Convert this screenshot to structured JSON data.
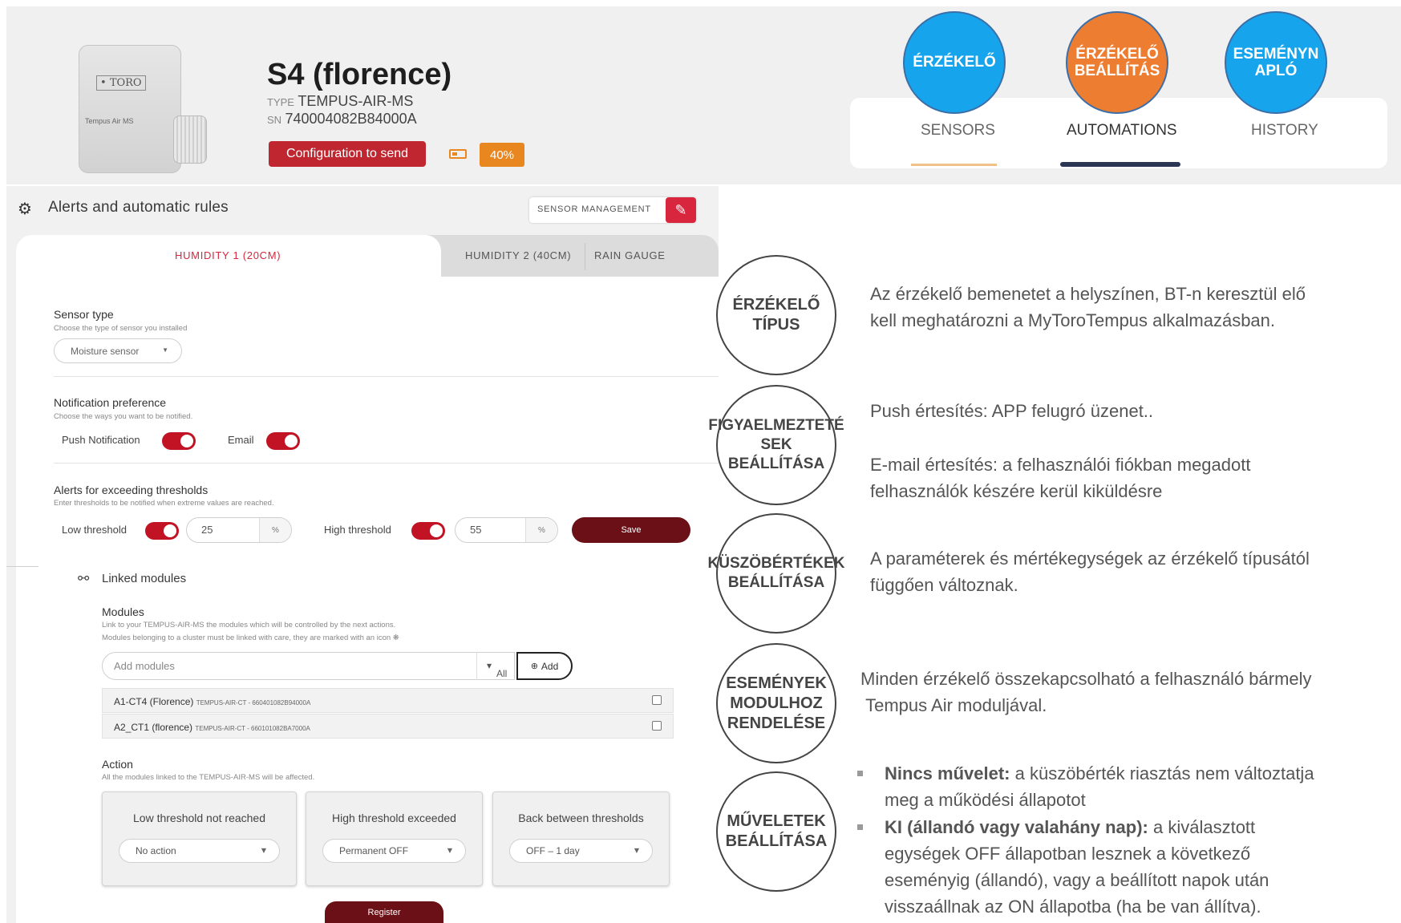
{
  "header": {
    "device": {
      "logo": "TORO",
      "model_name": "Tempus Air MS",
      "title": "S4 (florence)",
      "type_key": "TYPE",
      "type_value": "TEMPUS-AIR-MS",
      "sn_key": "SN",
      "sn_value": "740004082B84000A",
      "config_badge": "Configuration to send",
      "battery_label": "40%",
      "battery_level": 0.4
    },
    "nav": {
      "tabs": [
        {
          "label": "SENSORS"
        },
        {
          "label": "AUTOMATIONS",
          "active": true
        },
        {
          "label": "HISTORY"
        }
      ]
    },
    "overlay_bubbles": [
      {
        "label_1": "ÉRZÉKELŐ",
        "label_2": "",
        "color": "#16a5ec"
      },
      {
        "label_1": "ÉRZÉKELŐ",
        "label_2": "BEÁLLÍTÁS",
        "color": "#ed7d31"
      },
      {
        "label_1": "ESEMÉNYN",
        "label_2": "APLÓ",
        "color": "#16a5ec"
      }
    ]
  },
  "panel": {
    "title": "Alerts and automatic rules",
    "sensor_management": "SENSOR MANAGEMENT",
    "tabs": [
      {
        "label": "HUMIDITY 1 (20CM)",
        "active": true
      },
      {
        "label": "HUMIDITY 2 (40CM)"
      },
      {
        "label": "RAIN GAUGE"
      }
    ],
    "sensor_type": {
      "title": "Sensor type",
      "subtitle": "Choose the type of sensor you installed",
      "value": "Moisture sensor"
    },
    "notification": {
      "title": "Notification preference",
      "subtitle": "Choose the ways you want to be notified.",
      "push_label": "Push Notification",
      "push_on": true,
      "email_label": "Email",
      "email_on": true
    },
    "thresholds": {
      "title": "Alerts for exceeding thresholds",
      "subtitle": "Enter thresholds to be notified when extreme values are reached.",
      "low_label": "Low threshold",
      "low_on": true,
      "low_value": "25",
      "high_label": "High threshold",
      "high_on": true,
      "high_value": "55",
      "unit": "%",
      "save_label": "Save"
    },
    "linked": {
      "title": "Linked modules",
      "modules_title": "Modules",
      "modules_sub1": "Link to your TEMPUS-AIR-MS the modules which will be controlled by the next actions.",
      "modules_sub2": "Modules belonging to a cluster must be linked with care, they are marked with an icon",
      "input_placeholder": "Add modules",
      "filter_value": "All",
      "add_label": "Add",
      "modules": [
        {
          "name": "A1-CT4 (Florence)",
          "code": "TEMPUS-AIR-CT - 660401082B94000A",
          "checked": false
        },
        {
          "name": "A2_CT1 (florence)",
          "code": "TEMPUS-AIR-CT - 660101082BA7000A",
          "checked": false
        }
      ]
    },
    "action": {
      "title": "Action",
      "subtitle": "All the modules linked to the TEMPUS-AIR-MS will be affected.",
      "boxes": [
        {
          "title": "Low threshold not reached",
          "value": "No action"
        },
        {
          "title": "High threshold exceeded",
          "value": "Permanent OFF"
        },
        {
          "title": "Back between thresholds",
          "value": "OFF – 1 day"
        }
      ],
      "register_label": "Register"
    }
  },
  "annotations": {
    "circles": [
      {
        "l1": "ÉRZÉKELŐ",
        "l2": "TÍPUS",
        "l3": ""
      },
      {
        "l1": "FIGYAELMEZTETÉ",
        "l2": "SEK",
        "l3": "BEÁLLÍTÁSA"
      },
      {
        "l1": "KÜSZÖBÉRTÉKEK",
        "l2": "BEÁLLÍTÁSA",
        "l3": ""
      },
      {
        "l1": "ESEMÉNYEK",
        "l2": "MODULHOZ",
        "l3": "RENDELÉSE"
      },
      {
        "l1": "MŰVELETEK",
        "l2": "BEÁLLÍTÁSA",
        "l3": ""
      }
    ],
    "texts": {
      "sensor_type_1": "Az érzékelő bemenetet a helyszínen, BT-n keresztül elő",
      "sensor_type_2": "kell meghatározni a MyToroTempus alkalmazásban.",
      "push": "Push értesítés: APP felugró üzenet..",
      "email_1": "E-mail értesítés: a felhasználói fiókban megadott",
      "email_2": "felhasználók készére kerül kiküldésre",
      "thresh_1": "A paraméterek és mértékegységek az érzékelő típusától",
      "thresh_2": "függően változnak.",
      "link_1": "Minden érzékelő összekapcsolható a felhasználó bármely",
      "link_2": "Tempus Air moduljával.",
      "b1_bold": "Nincs művelet:",
      "b1_rest": " a küszöbérték riasztás nem változtatja",
      "b1_cont": "meg a működési állapotot",
      "b2_bold": "KI (állandó vagy valahány nap):",
      "b2_rest": " a kiválasztott",
      "b2_cont1": "egységek OFF állapotban lesznek a következő",
      "b2_cont2": "eseményig (állandó), vagy a beállított napok után",
      "b2_cont3": "visszaállnak az ON állapotba (ha be van állítva)."
    }
  }
}
